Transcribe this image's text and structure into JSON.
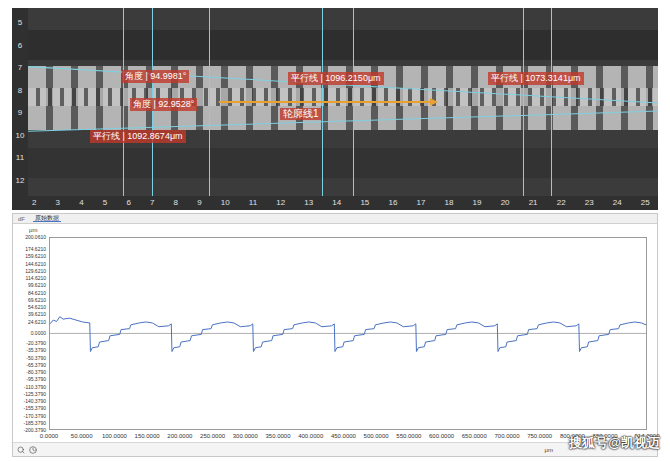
{
  "image_view": {
    "vertical_ruler": [
      "5",
      "6",
      "7",
      "8",
      "9",
      "10",
      "11",
      "12"
    ],
    "horizontal_ruler": [
      "2",
      "3",
      "4",
      "5",
      "6",
      "7",
      "8",
      "9",
      "10",
      "11",
      "12",
      "13",
      "14",
      "15",
      "16",
      "17",
      "18",
      "19",
      "20",
      "21",
      "22",
      "23",
      "24",
      "25"
    ],
    "annotations": [
      {
        "text": "角度 | 94.9981°"
      },
      {
        "text": "角度 | 92.9528°"
      },
      {
        "text": "平行线 | 1092.8674μm"
      },
      {
        "text": "平行线 | 1096.2150μm"
      },
      {
        "text": "平行线 | 1073.3141μm"
      }
    ],
    "profile_label": "轮廓线1"
  },
  "chart_panel": {
    "tabs": [
      {
        "label": "dF",
        "selected": false
      },
      {
        "label": "原始数据",
        "selected": true
      }
    ],
    "y_unit": "μm",
    "x_unit": "μm",
    "y_ticks": [
      "200.0610",
      "174.6210",
      "159.6210",
      "144.6210",
      "129.6210",
      "114.6210",
      "99.6210",
      "84.6210",
      "69.6210",
      "54.6210",
      "39.6210",
      "24.6210",
      "0.0000",
      "-20.3790",
      "-35.3790",
      "-50.3790",
      "-65.3790",
      "-80.3790",
      "-95.3790",
      "-110.3790",
      "-125.3790",
      "-140.3790",
      "-155.3790",
      "-170.3790",
      "-185.3790",
      "-200.3790"
    ],
    "x_ticks": [
      "0.0000",
      "50.0000",
      "100.0000",
      "150.0000",
      "200.0000",
      "250.0000",
      "300.0000",
      "350.0000",
      "400.0000",
      "450.0000",
      "500.0000",
      "550.0000",
      "600.0000",
      "650.0000",
      "700.0000",
      "750.0000",
      "800.0000",
      "850.0000",
      "914.0000"
    ],
    "series": [
      {
        "color": "#4a72c4",
        "points": [
          [
            0,
            20
          ],
          [
            5,
            28
          ],
          [
            10,
            25
          ],
          [
            15,
            35
          ],
          [
            20,
            30
          ],
          [
            30,
            32
          ],
          [
            40,
            28
          ],
          [
            50,
            24
          ],
          [
            61,
            22
          ],
          [
            62,
            -38
          ],
          [
            65,
            -30
          ],
          [
            74,
            -28
          ],
          [
            76,
            -18
          ],
          [
            90,
            -15
          ],
          [
            92,
            -5
          ],
          [
            107,
            -2
          ],
          [
            109,
            8
          ],
          [
            122,
            10
          ],
          [
            124,
            18
          ],
          [
            137,
            22
          ],
          [
            147,
            24
          ],
          [
            157,
            22
          ],
          [
            167,
            14
          ],
          [
            182,
            16
          ],
          [
            186,
            20
          ],
          [
            187,
            -38
          ],
          [
            190,
            -30
          ],
          [
            199,
            -28
          ],
          [
            201,
            -18
          ],
          [
            215,
            -15
          ],
          [
            217,
            -5
          ],
          [
            232,
            -2
          ],
          [
            234,
            8
          ],
          [
            247,
            10
          ],
          [
            249,
            18
          ],
          [
            262,
            22
          ],
          [
            272,
            24
          ],
          [
            282,
            22
          ],
          [
            292,
            14
          ],
          [
            307,
            16
          ],
          [
            311,
            20
          ],
          [
            312,
            -38
          ],
          [
            315,
            -30
          ],
          [
            324,
            -28
          ],
          [
            326,
            -18
          ],
          [
            340,
            -15
          ],
          [
            342,
            -5
          ],
          [
            357,
            -2
          ],
          [
            359,
            8
          ],
          [
            372,
            10
          ],
          [
            374,
            18
          ],
          [
            387,
            22
          ],
          [
            397,
            24
          ],
          [
            407,
            22
          ],
          [
            417,
            14
          ],
          [
            432,
            16
          ],
          [
            436,
            20
          ],
          [
            437,
            -38
          ],
          [
            440,
            -30
          ],
          [
            449,
            -28
          ],
          [
            451,
            -18
          ],
          [
            465,
            -15
          ],
          [
            467,
            -5
          ],
          [
            482,
            -2
          ],
          [
            484,
            8
          ],
          [
            497,
            10
          ],
          [
            499,
            18
          ],
          [
            512,
            22
          ],
          [
            522,
            24
          ],
          [
            532,
            22
          ],
          [
            542,
            14
          ],
          [
            557,
            16
          ],
          [
            561,
            20
          ],
          [
            562,
            -38
          ],
          [
            565,
            -30
          ],
          [
            574,
            -28
          ],
          [
            576,
            -18
          ],
          [
            590,
            -15
          ],
          [
            592,
            -5
          ],
          [
            607,
            -2
          ],
          [
            609,
            8
          ],
          [
            622,
            10
          ],
          [
            624,
            18
          ],
          [
            637,
            22
          ],
          [
            647,
            24
          ],
          [
            657,
            22
          ],
          [
            667,
            14
          ],
          [
            682,
            16
          ],
          [
            686,
            20
          ],
          [
            687,
            -38
          ],
          [
            690,
            -30
          ],
          [
            699,
            -28
          ],
          [
            701,
            -18
          ],
          [
            715,
            -15
          ],
          [
            717,
            -5
          ],
          [
            732,
            -2
          ],
          [
            734,
            8
          ],
          [
            747,
            10
          ],
          [
            749,
            18
          ],
          [
            762,
            22
          ],
          [
            772,
            24
          ],
          [
            782,
            22
          ],
          [
            792,
            14
          ],
          [
            807,
            16
          ],
          [
            811,
            20
          ],
          [
            812,
            -38
          ],
          [
            815,
            -30
          ],
          [
            824,
            -28
          ],
          [
            826,
            -18
          ],
          [
            840,
            -15
          ],
          [
            842,
            -5
          ],
          [
            857,
            -2
          ],
          [
            859,
            8
          ],
          [
            872,
            10
          ],
          [
            874,
            18
          ],
          [
            887,
            22
          ],
          [
            897,
            24
          ],
          [
            907,
            22
          ],
          [
            914,
            18
          ]
        ]
      }
    ]
  },
  "watermark": "搜狐号@凯视迈"
}
